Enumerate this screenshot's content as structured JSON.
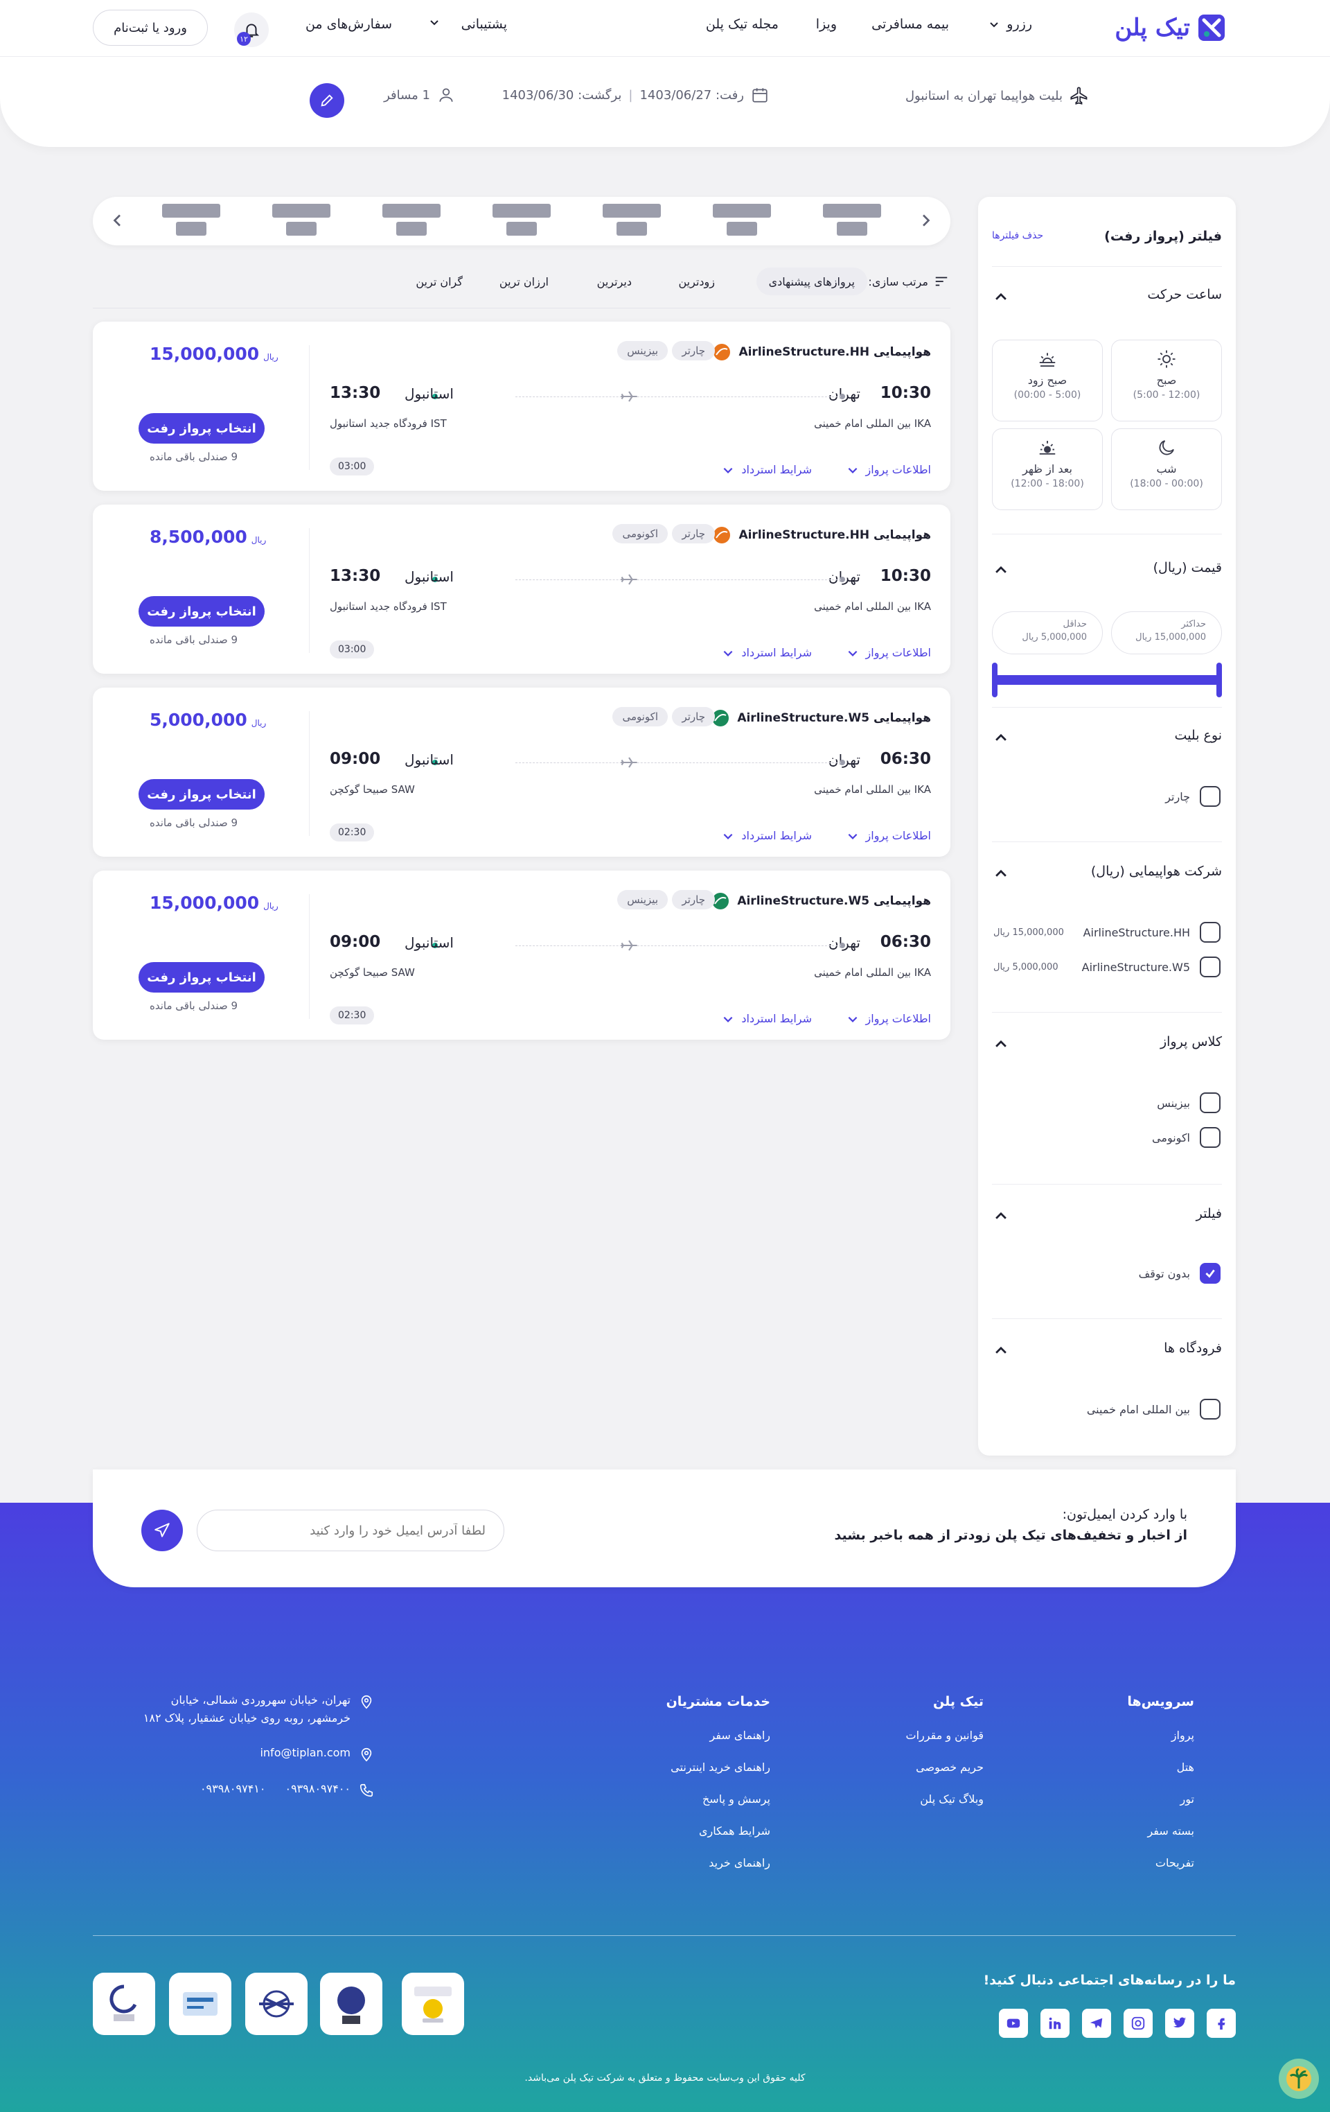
{
  "header": {
    "brand": "تیک پلن",
    "nav": {
      "reserve": "رزرو",
      "insurance": "بیمه مسافرتی",
      "visa": "ویزا",
      "magazine": "مجله تیک پلن",
      "support": "پشتیبانی",
      "orders": "سفارش‌های من"
    },
    "notifications_count": "۱۲",
    "login": "ورود یا ثبت‌نام"
  },
  "search": {
    "route": "بلیت هواپیما تهران به استانبول",
    "depart": "رفت: 1403/06/27",
    "return": "برگشت: 1403/06/30",
    "passengers": "1 مسافر"
  },
  "filters": {
    "title": "فیلتر (پرواز رفت)",
    "reset": "حذف فیلترها",
    "departure_time": {
      "title": "ساعت حرکت",
      "slots": [
        {
          "label": "صبح",
          "range": "(12:00 - 5:00)"
        },
        {
          "label": "صبح زود",
          "range": "(5:00 - 00:00)"
        },
        {
          "label": "شب",
          "range": "(00:00 - 18:00)"
        },
        {
          "label": "بعد از ظهر",
          "range": "(18:00 - 12:00)"
        }
      ]
    },
    "price": {
      "title": "قیمت (ریال)",
      "max_label": "حداکثر",
      "max_value": "15,000,000 ریال",
      "min_label": "حداقل",
      "min_value": "5,000,000 ریال"
    },
    "ticket_type": {
      "title": "نوع بلیت",
      "options": [
        {
          "label": "چارتر",
          "checked": false
        }
      ]
    },
    "airline": {
      "title": "شرکت هواپیمایی (ریال)",
      "options": [
        {
          "label": "AirlineStructure.HH",
          "price": "15,000,000 ریال",
          "checked": false
        },
        {
          "label": "AirlineStructure.W5",
          "price": "5,000,000 ریال",
          "checked": false
        }
      ]
    },
    "flight_class": {
      "title": "کلاس پرواز",
      "options": [
        {
          "label": "بیزینس",
          "checked": false
        },
        {
          "label": "اکونومی",
          "checked": false
        }
      ]
    },
    "stops": {
      "title": "فیلتر",
      "options": [
        {
          "label": "بدون توقف",
          "checked": true
        }
      ]
    },
    "airports": {
      "title": "فرودگاه ها",
      "options": [
        {
          "label": "بین المللی امام خمینی",
          "checked": false
        }
      ]
    }
  },
  "sort": {
    "label": "مرتب سازی:",
    "options": [
      "پروازهای پیشنهادی",
      "زودترین",
      "دیرترین",
      "ارزان ترین",
      "گران ترین"
    ],
    "active": "پروازهای پیشنهادی"
  },
  "flights": [
    {
      "airline": "هواپیمایی AirlineStructure.HH",
      "class": "بیزینس",
      "type": "چارتر",
      "dep_city": "تهران",
      "dep_time": "10:30",
      "dep_airport": "IKA بین المللی امام خمینی",
      "arr_city": "استانبول",
      "arr_time": "13:30",
      "arr_airport": "IST فرودگاه جدید استانبول",
      "duration": "03:00",
      "price": "15,000,000",
      "currency": "ریال",
      "select": "انتخاب پرواز رفت",
      "seats": "9 صندلی باقی مانده",
      "info": "اطلاعات پرواز",
      "refund": "شرایط استرداد",
      "logo_color": "#e8741c"
    },
    {
      "airline": "هواپیمایی AirlineStructure.HH",
      "class": "اکونومی",
      "type": "چارتر",
      "dep_city": "تهران",
      "dep_time": "10:30",
      "dep_airport": "IKA بین المللی امام خمینی",
      "arr_city": "استانبول",
      "arr_time": "13:30",
      "arr_airport": "IST فرودگاه جدید استانبول",
      "duration": "03:00",
      "price": "8,500,000",
      "currency": "ریال",
      "select": "انتخاب پرواز رفت",
      "seats": "9 صندلی باقی مانده",
      "info": "اطلاعات پرواز",
      "refund": "شرایط استرداد",
      "logo_color": "#e8741c"
    },
    {
      "airline": "هواپیمایی AirlineStructure.W5",
      "class": "اکونومی",
      "type": "چارتر",
      "dep_city": "تهران",
      "dep_time": "06:30",
      "dep_airport": "IKA بین المللی امام خمینی",
      "arr_city": "استانبول",
      "arr_time": "09:00",
      "arr_airport": "SAW صبیحا گوکچن",
      "duration": "02:30",
      "price": "5,000,000",
      "currency": "ریال",
      "select": "انتخاب پرواز رفت",
      "seats": "9 صندلی باقی مانده",
      "info": "اطلاعات پرواز",
      "refund": "شرایط استرداد",
      "logo_color": "#1a8a5a"
    },
    {
      "airline": "هواپیمایی AirlineStructure.W5",
      "class": "بیزینس",
      "type": "چارتر",
      "dep_city": "تهران",
      "dep_time": "06:30",
      "dep_airport": "IKA بین المللی امام خمینی",
      "arr_city": "استانبول",
      "arr_time": "09:00",
      "arr_airport": "SAW صبیحا گوکچن",
      "duration": "02:30",
      "price": "15,000,000",
      "currency": "ریال",
      "select": "انتخاب پرواز رفت",
      "seats": "9 صندلی باقی مانده",
      "info": "اطلاعات پرواز",
      "refund": "شرایط استرداد",
      "logo_color": "#1a8a5a"
    }
  ],
  "newsletter": {
    "line1": "با وارد کردن ایمیل‌تون:",
    "line2": "از اخبار و تخفیف‌های تیک پلن زودتر از همه باخبر بشید",
    "placeholder": "لطفا آدرس ایمیل خود را وارد کنید"
  },
  "footer": {
    "services": {
      "title": "سرویس‌ها",
      "links": [
        "پرواز",
        "هتل",
        "تور",
        "بسته سفر",
        "تفریحات"
      ]
    },
    "tikplan": {
      "title": "تیک پلن",
      "links": [
        "قوانین و مقررات",
        "حریم خصوصی",
        "وبلاگ تیک پلن"
      ]
    },
    "customer": {
      "title": "خدمات مشتریان",
      "links": [
        "راهنمای سفر",
        "راهنمای خرید اینترنتی",
        "پرسش و پاسخ",
        "شرایط همکاری",
        "راهنمای خرید"
      ]
    },
    "address": "تهران، خیابان سهروردی شمالی، خیابان خرمشهر، روبه روی خیابان عشقیار، پلاک ۱۸۲",
    "email": "info@tiplan.com",
    "phone1": "۰۹۳۹۸۰۹۷۴۰۰",
    "phone2": "۰۹۳۹۸۰۹۷۴۱۰",
    "social_title": "ما را در رسانه‌های اجتماعی دنبال کنید!",
    "copyright": "کلیه حقوق این وب‌سایت محفوظ و متعلق به شرکت تیک پلن می‌باشد."
  },
  "colors": {
    "primary": "#4b3fe0",
    "teal": "#1fa5a0",
    "green_dot": "#1ab394"
  }
}
